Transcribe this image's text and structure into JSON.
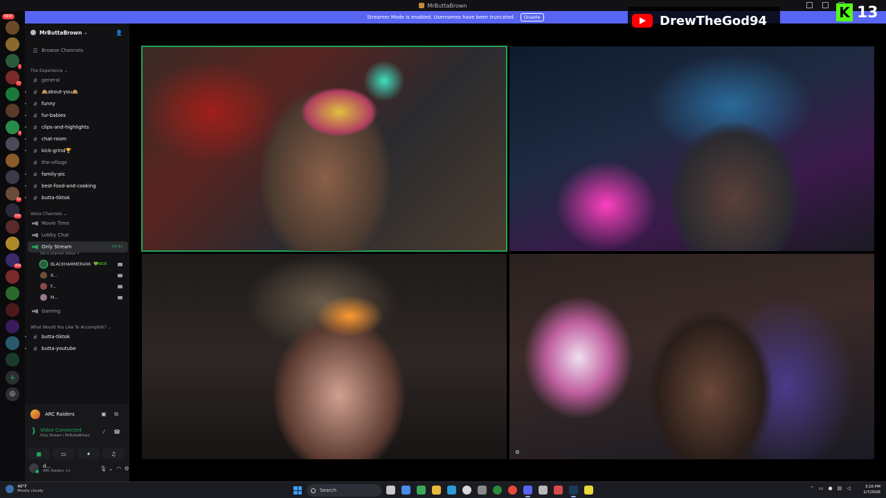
{
  "window": {
    "title": "MrButtaBrown"
  },
  "banner": {
    "text": "Streamer Mode is enabled. Usernames have been truncated.",
    "disable_label": "Disable"
  },
  "rail": {
    "new_badge": "NEW",
    "badges": [
      "7",
      "17",
      "3",
      "10",
      "183",
      "408"
    ]
  },
  "server": {
    "name": "MrButtaBrown",
    "browse_label": "Browse Channels"
  },
  "categories": {
    "experience": "The Experience",
    "voice": "Voice Channels",
    "accomplish": "What Would You Like To Accomplish?"
  },
  "channels": {
    "general": "general",
    "about_you": "🙈about-you🙈",
    "funny": "funny",
    "fur_babies": "fur-babies",
    "clips": "clips-and-highlights",
    "chat_room": "chat-room",
    "kick_grind": "kick-grind🏆",
    "the_village": "the-village",
    "family_pic": "family-pic",
    "best_food": "best-food-and-cooking",
    "butta_tiktok": "butta-tiktok",
    "movie_time": "Movie Time",
    "lobby_chat": "Lobby Chat",
    "only_stream": "Only Stream",
    "only_stream_time": "59:41",
    "set_status": "Set a channel status ✎",
    "gaming": "Gaming",
    "butta_tiktok_2": "butta-tiktok",
    "butta_youtube": "butta-youtube"
  },
  "voice_users": [
    {
      "name": "BLACKHAMMER406",
      "tag": "💚KICK"
    },
    {
      "name": "d...",
      "tag": ""
    },
    {
      "name": "F...",
      "tag": ""
    },
    {
      "name": "M...",
      "tag": ""
    }
  ],
  "panel": {
    "game": "ARC Raiders",
    "connection": "Video Connected",
    "location": "Only Stream / MrButtaBrown",
    "username": "d...",
    "user_status": "ARC Raiders +1"
  },
  "overlay": {
    "youtube_name": "DrewTheGod94",
    "kick_letter": "K",
    "kick_count": "13"
  },
  "taskbar": {
    "temp": "46°F",
    "weather": "Mostly cloudy",
    "search": "Search",
    "time": "3:10 PM",
    "date": "1/7/2026"
  },
  "colors": {
    "accent": "#5865f2",
    "online": "#23a55a",
    "kick": "#53fc18",
    "youtube": "#ff0000"
  }
}
